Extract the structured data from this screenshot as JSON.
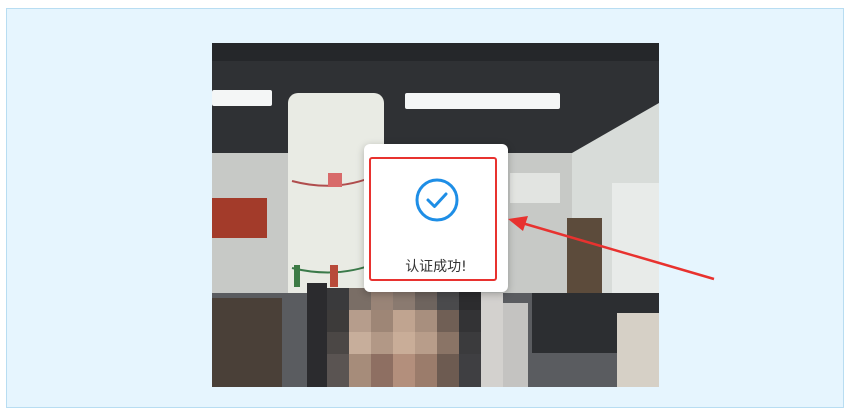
{
  "dialog": {
    "message": "认证成功!",
    "icon": "check-circle-icon"
  },
  "colors": {
    "page_bg": "#e6f5fe",
    "frame_border": "#b8ddf2",
    "success_blue": "#1e8ee6",
    "annotation_red": "#e8322f"
  }
}
